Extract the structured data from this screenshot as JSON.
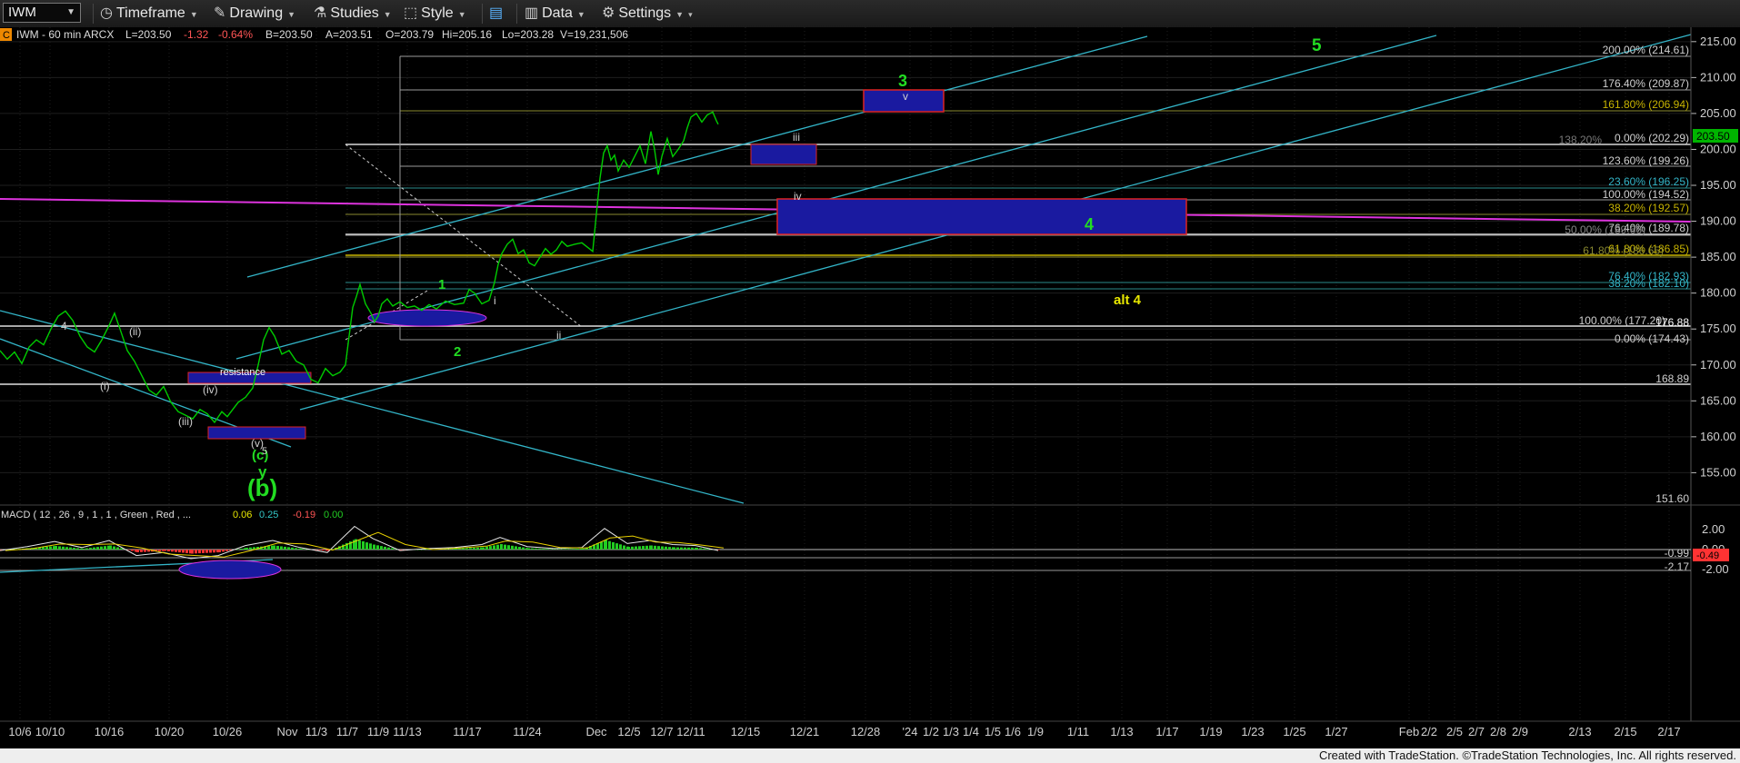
{
  "toolbar": {
    "symbol": "IWM",
    "timeframe": "Timeframe",
    "drawing": "Drawing",
    "studies": "Studies",
    "style": "Style",
    "data": "Data",
    "settings": "Settings"
  },
  "header_line": {
    "badge": "C",
    "text": "IWM - 60 min  ARCX",
    "last": "L=203.50",
    "change": "-1.32",
    "pct": "-0.64%",
    "bid": "B=203.50",
    "ask": "A=203.51",
    "open": "O=203.79",
    "high": "Hi=205.16",
    "low": "Lo=203.28",
    "volume": "V=19,231,506"
  },
  "colors": {
    "price": "#00cc00",
    "wave_green": "#22dd22",
    "wave_white": "#d0d0d0",
    "channel": "#33b5c8",
    "magenta": "#dd33dd",
    "box_fill": "#1a1aa0",
    "box_border": "#dd2222",
    "fib_yellow": "#c8b400",
    "last_price_bg": "#00b400",
    "macd_red": "#ff3333"
  },
  "price_axis": {
    "labels": [
      "215.00",
      "210.00",
      "205.00",
      "200.00",
      "195.00",
      "190.00",
      "185.00",
      "180.00",
      "175.00",
      "170.00",
      "165.00",
      "160.00",
      "155.00"
    ],
    "last_price": "203.50"
  },
  "macd_axis": {
    "labels": [
      "2.00",
      "0.00",
      "-2.00"
    ],
    "last_value": "-0.49"
  },
  "macd_header": {
    "name": "MACD ( 12 , 26 , 9 , 1 , 1 , Green , Red , ...",
    "v1": "0.06",
    "v2": "0.25",
    "v3": "-0.19",
    "v4": "0.00"
  },
  "fib_labels": [
    "200.00% (214.61)",
    "176.40% (209.87)",
    "161.80% (206.94)",
    "0.00% (202.29)",
    "138.20%",
    "123.60% (199.26)",
    "23.60% (196.25)",
    "100.00% (194.52)",
    "38.20% (192.57)",
    "76.40% (189.78)",
    "50.00% (189.66)",
    "61.80% (186.85)",
    "61.80% (186.65)",
    "76.40% (182.93)",
    "38.20% (182.10)",
    "100.00% (177.20)",
    "176.88",
    "0.00% (174.43)",
    "168.89",
    "151.60",
    "-0.99",
    "-2.17"
  ],
  "wave_labels": {
    "w5": "5",
    "w3": "3",
    "w4": "4",
    "alt4": "alt 4",
    "w1": "1",
    "w2": "2",
    "b": "(b)",
    "y": "y",
    "c": "(c)",
    "v_paren": "(v)",
    "iv_paren": "(iv)",
    "iii_paren": "(iii)",
    "ii_paren": "(ii)",
    "i_paren": "(i)",
    "four_small": "4",
    "five_small": "5",
    "i_small": "i",
    "ii_small": "ii",
    "iii_small": "iii",
    "iv_small": "iv",
    "v_small": "v",
    "resistance": "resistance"
  },
  "x_axis": {
    "labels": [
      "10/6",
      "10/10",
      "10/16",
      "10/20",
      "10/26",
      "Nov",
      "11/3",
      "11/7",
      "11/9",
      "11/13",
      "11/17",
      "11/24",
      "Dec",
      "12/5",
      "12/7",
      "12/11",
      "12/15",
      "12/21",
      "12/28",
      "'24",
      "1/2",
      "1/3",
      "1/4",
      "1/5",
      "1/6",
      "1/9",
      "1/11",
      "1/13",
      "1/17",
      "1/19",
      "1/23",
      "1/25",
      "1/27",
      "Feb",
      "2/2",
      "2/5",
      "2/7",
      "2/8",
      "2/9",
      "2/13",
      "2/15",
      "2/17"
    ]
  },
  "footer": "Created with TradeStation. ©TradeStation Technologies, Inc. All rights reserved.",
  "chart_data": {
    "type": "line",
    "title": "IWM - 60 min",
    "price_range": [
      150.5,
      217.0
    ],
    "macd_range": [
      -2.8,
      2.8
    ],
    "price_series": [
      [
        0,
        172.0
      ],
      [
        8,
        170.8
      ],
      [
        16,
        171.8
      ],
      [
        24,
        170.2
      ],
      [
        32,
        172.5
      ],
      [
        40,
        173.5
      ],
      [
        48,
        172.8
      ],
      [
        56,
        175.0
      ],
      [
        64,
        176.8
      ],
      [
        72,
        177.5
      ],
      [
        80,
        176.2
      ],
      [
        88,
        174.0
      ],
      [
        96,
        172.5
      ],
      [
        104,
        171.8
      ],
      [
        112,
        173.5
      ],
      [
        120,
        175.5
      ],
      [
        126,
        177.2
      ],
      [
        132,
        175.0
      ],
      [
        140,
        172.0
      ],
      [
        148,
        170.5
      ],
      [
        156,
        168.5
      ],
      [
        164,
        166.5
      ],
      [
        172,
        165.8
      ],
      [
        180,
        167.0
      ],
      [
        188,
        164.8
      ],
      [
        196,
        163.5
      ],
      [
        204,
        163.0
      ],
      [
        212,
        162.5
      ],
      [
        220,
        163.8
      ],
      [
        228,
        163.2
      ],
      [
        236,
        162.0
      ],
      [
        244,
        163.5
      ],
      [
        250,
        162.8
      ],
      [
        256,
        163.8
      ],
      [
        262,
        164.8
      ],
      [
        270,
        165.5
      ],
      [
        278,
        166.8
      ],
      [
        284,
        170.0
      ],
      [
        290,
        173.5
      ],
      [
        296,
        175.2
      ],
      [
        302,
        174.0
      ],
      [
        310,
        171.5
      ],
      [
        318,
        172.0
      ],
      [
        326,
        170.5
      ],
      [
        334,
        170.0
      ],
      [
        342,
        168.0
      ],
      [
        350,
        167.5
      ],
      [
        358,
        169.5
      ],
      [
        366,
        168.5
      ],
      [
        374,
        169.0
      ],
      [
        380,
        170.0
      ],
      [
        384,
        174.0
      ],
      [
        388,
        178.0
      ],
      [
        392,
        179.5
      ],
      [
        396,
        181.2
      ],
      [
        402,
        178.5
      ],
      [
        408,
        177.2
      ],
      [
        412,
        176.0
      ],
      [
        416,
        176.8
      ],
      [
        420,
        178.5
      ],
      [
        426,
        179.2
      ],
      [
        432,
        178.2
      ],
      [
        440,
        178.8
      ],
      [
        448,
        178.0
      ],
      [
        456,
        178.2
      ],
      [
        464,
        177.6
      ],
      [
        472,
        178.4
      ],
      [
        480,
        177.8
      ],
      [
        490,
        178.9
      ],
      [
        500,
        178.4
      ],
      [
        510,
        178.6
      ],
      [
        516,
        180.5
      ],
      [
        522,
        180.0
      ],
      [
        530,
        178.5
      ],
      [
        538,
        179.0
      ],
      [
        544,
        181.5
      ],
      [
        548,
        184.0
      ],
      [
        552,
        185.5
      ],
      [
        558,
        186.8
      ],
      [
        564,
        187.5
      ],
      [
        570,
        185.5
      ],
      [
        576,
        186.0
      ],
      [
        582,
        184.2
      ],
      [
        588,
        183.8
      ],
      [
        594,
        185.0
      ],
      [
        600,
        186.2
      ],
      [
        606,
        185.4
      ],
      [
        612,
        186.0
      ],
      [
        618,
        187.2
      ],
      [
        624,
        186.5
      ],
      [
        632,
        186.8
      ],
      [
        640,
        187.0
      ],
      [
        648,
        186.2
      ],
      [
        652,
        185.8
      ],
      [
        656,
        191.0
      ],
      [
        660,
        196.0
      ],
      [
        664,
        199.5
      ],
      [
        668,
        200.5
      ],
      [
        672,
        198.5
      ],
      [
        676,
        199.2
      ],
      [
        680,
        197.0
      ],
      [
        686,
        198.5
      ],
      [
        692,
        197.5
      ],
      [
        698,
        199.0
      ],
      [
        704,
        200.5
      ],
      [
        710,
        198.0
      ],
      [
        716,
        202.5
      ],
      [
        720,
        200.0
      ],
      [
        724,
        196.5
      ],
      [
        728,
        199.0
      ],
      [
        734,
        201.5
      ],
      [
        740,
        199.0
      ],
      [
        746,
        200.0
      ],
      [
        752,
        201.2
      ],
      [
        756,
        203.0
      ],
      [
        760,
        204.5
      ],
      [
        766,
        205.0
      ],
      [
        772,
        203.8
      ],
      [
        778,
        204.8
      ],
      [
        784,
        205.2
      ],
      [
        788,
        204.0
      ],
      [
        790,
        203.5
      ]
    ],
    "macd_series": [
      [
        0,
        -0.1
      ],
      [
        30,
        0.3
      ],
      [
        60,
        0.8
      ],
      [
        90,
        0.2
      ],
      [
        120,
        0.9
      ],
      [
        150,
        -0.6
      ],
      [
        180,
        -0.3
      ],
      [
        210,
        -0.9
      ],
      [
        240,
        -0.6
      ],
      [
        270,
        0.4
      ],
      [
        300,
        0.9
      ],
      [
        330,
        0.2
      ],
      [
        360,
        -0.3
      ],
      [
        390,
        2.3
      ],
      [
        410,
        1.1
      ],
      [
        440,
        -0.1
      ],
      [
        470,
        0.1
      ],
      [
        500,
        0.2
      ],
      [
        530,
        0.5
      ],
      [
        550,
        1.2
      ],
      [
        580,
        0.3
      ],
      [
        610,
        0.1
      ],
      [
        640,
        0.2
      ],
      [
        665,
        2.1
      ],
      [
        690,
        0.6
      ],
      [
        715,
        0.9
      ],
      [
        740,
        0.5
      ],
      [
        765,
        0.4
      ],
      [
        790,
        -0.1
      ]
    ]
  }
}
